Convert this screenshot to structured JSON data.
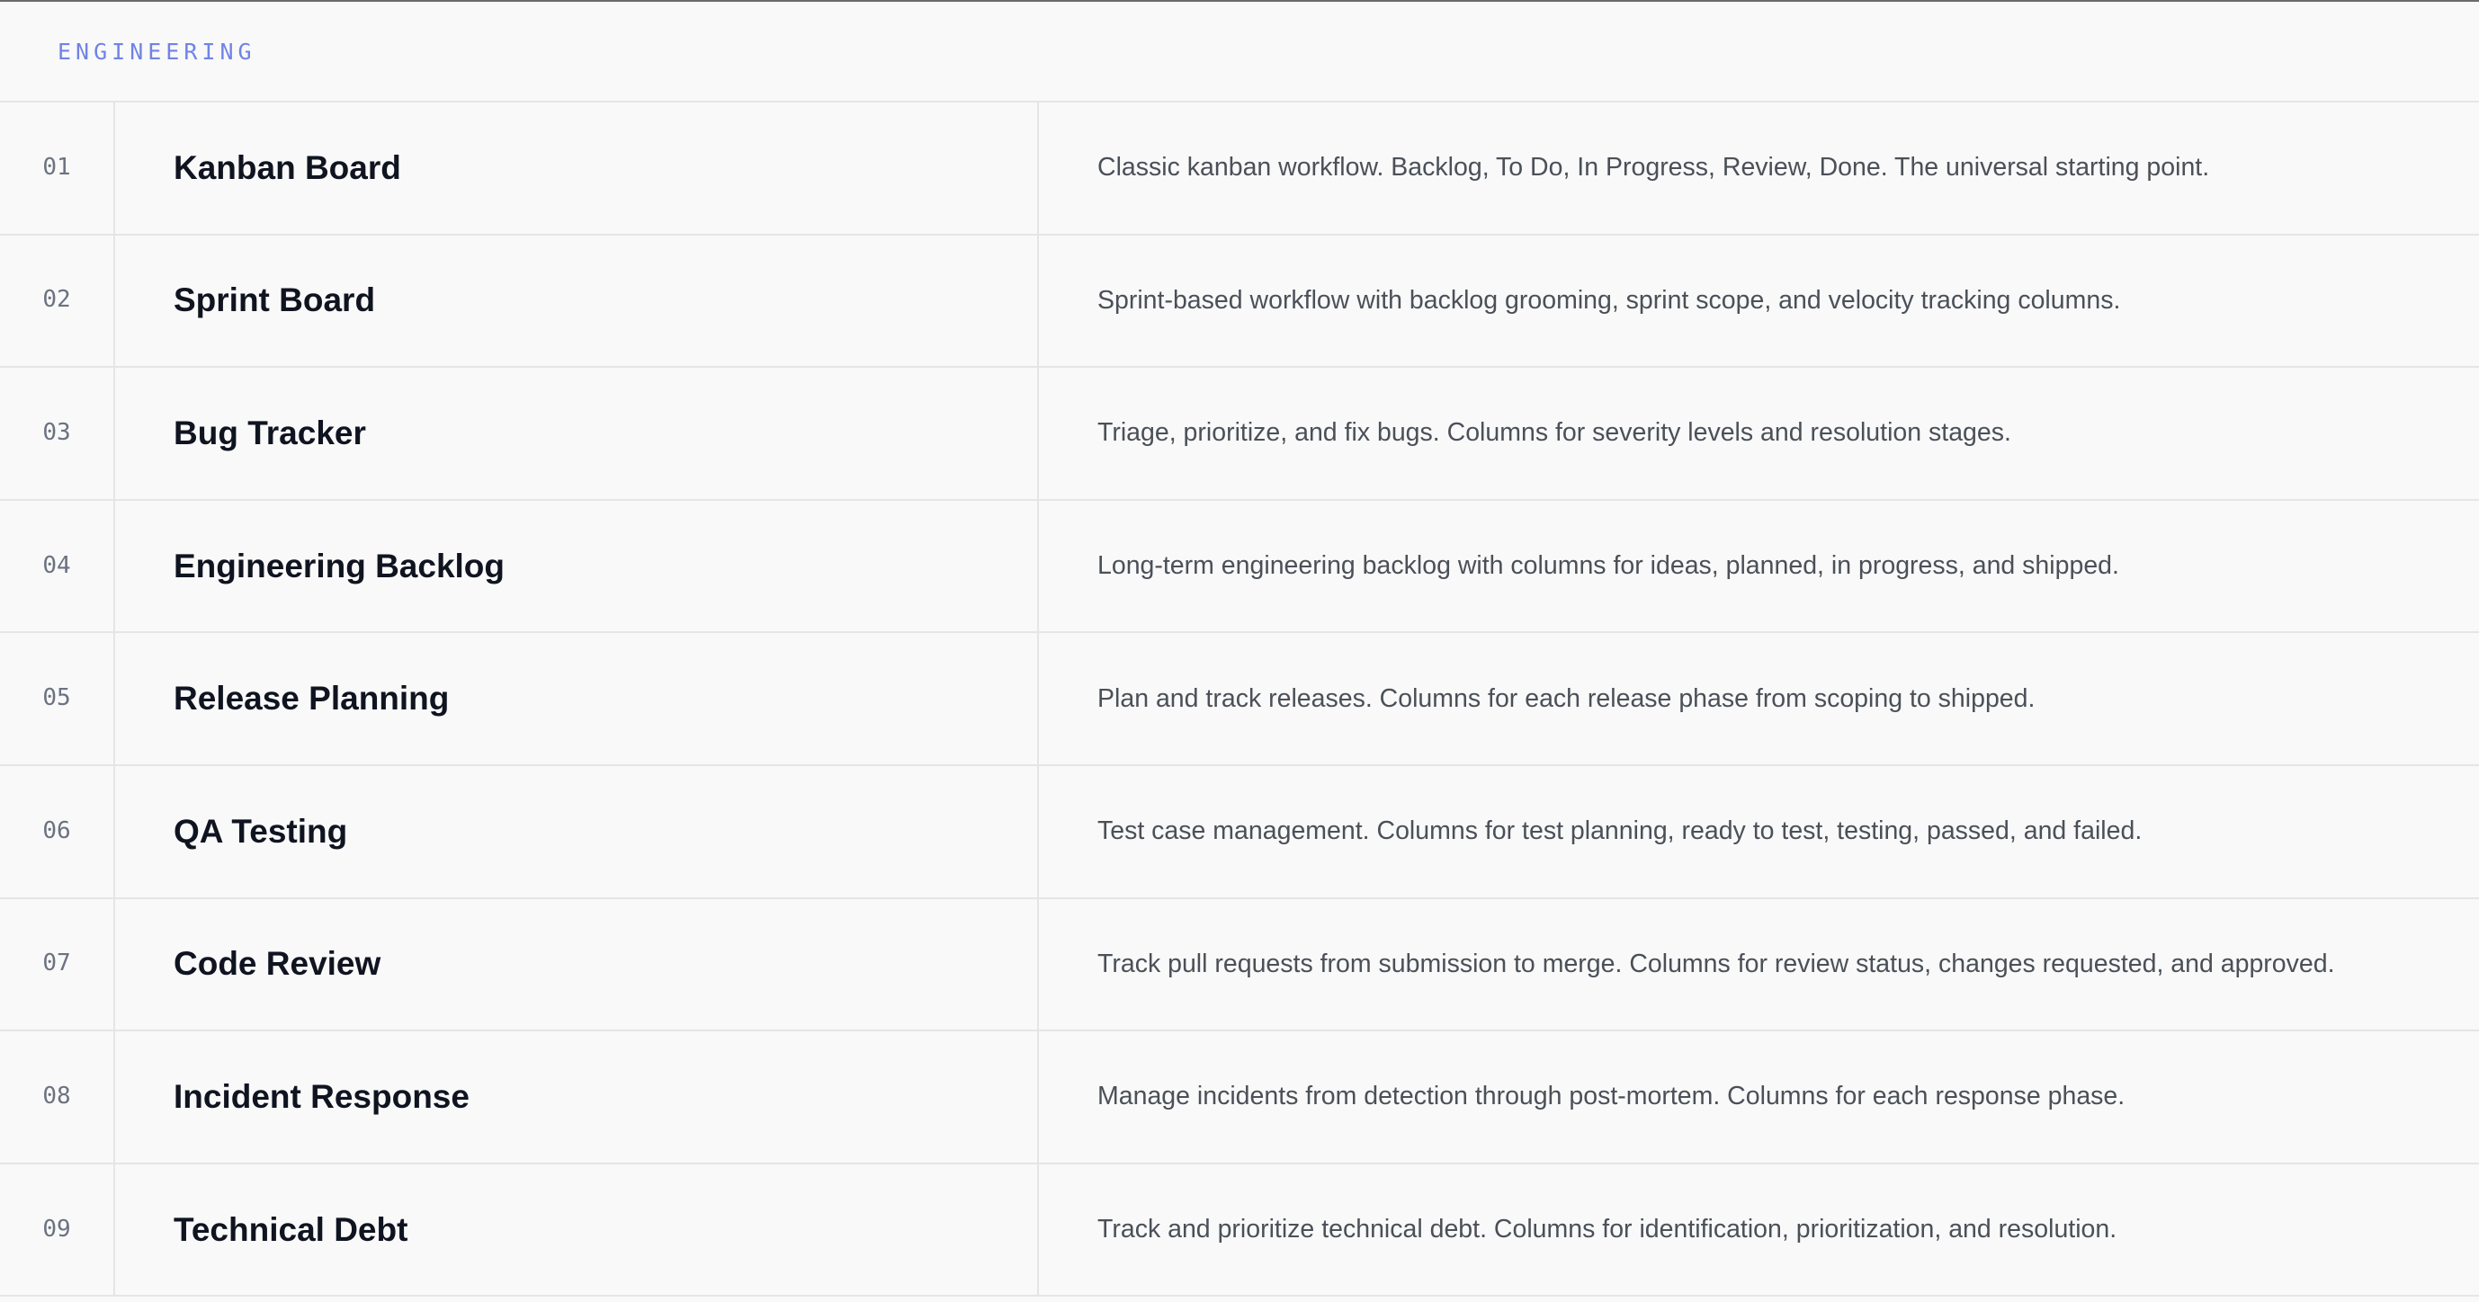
{
  "section": {
    "label": "ENGINEERING"
  },
  "templates": [
    {
      "number": "01",
      "name": "Kanban Board",
      "description": "Classic kanban workflow. Backlog, To Do, In Progress, Review, Done. The universal starting point."
    },
    {
      "number": "02",
      "name": "Sprint Board",
      "description": "Sprint-based workflow with backlog grooming, sprint scope, and velocity tracking columns."
    },
    {
      "number": "03",
      "name": "Bug Tracker",
      "description": "Triage, prioritize, and fix bugs. Columns for severity levels and resolution stages."
    },
    {
      "number": "04",
      "name": "Engineering Backlog",
      "description": "Long-term engineering backlog with columns for ideas, planned, in progress, and shipped."
    },
    {
      "number": "05",
      "name": "Release Planning",
      "description": "Plan and track releases. Columns for each release phase from scoping to shipped."
    },
    {
      "number": "06",
      "name": "QA Testing",
      "description": "Test case management. Columns for test planning, ready to test, testing, passed, and failed."
    },
    {
      "number": "07",
      "name": "Code Review",
      "description": "Track pull requests from submission to merge. Columns for review status, changes requested, and approved."
    },
    {
      "number": "08",
      "name": "Incident Response",
      "description": "Manage incidents from detection through post-mortem. Columns for each response phase."
    },
    {
      "number": "09",
      "name": "Technical Debt",
      "description": "Track and prioritize technical debt. Columns for identification, prioritization, and resolution."
    }
  ]
}
